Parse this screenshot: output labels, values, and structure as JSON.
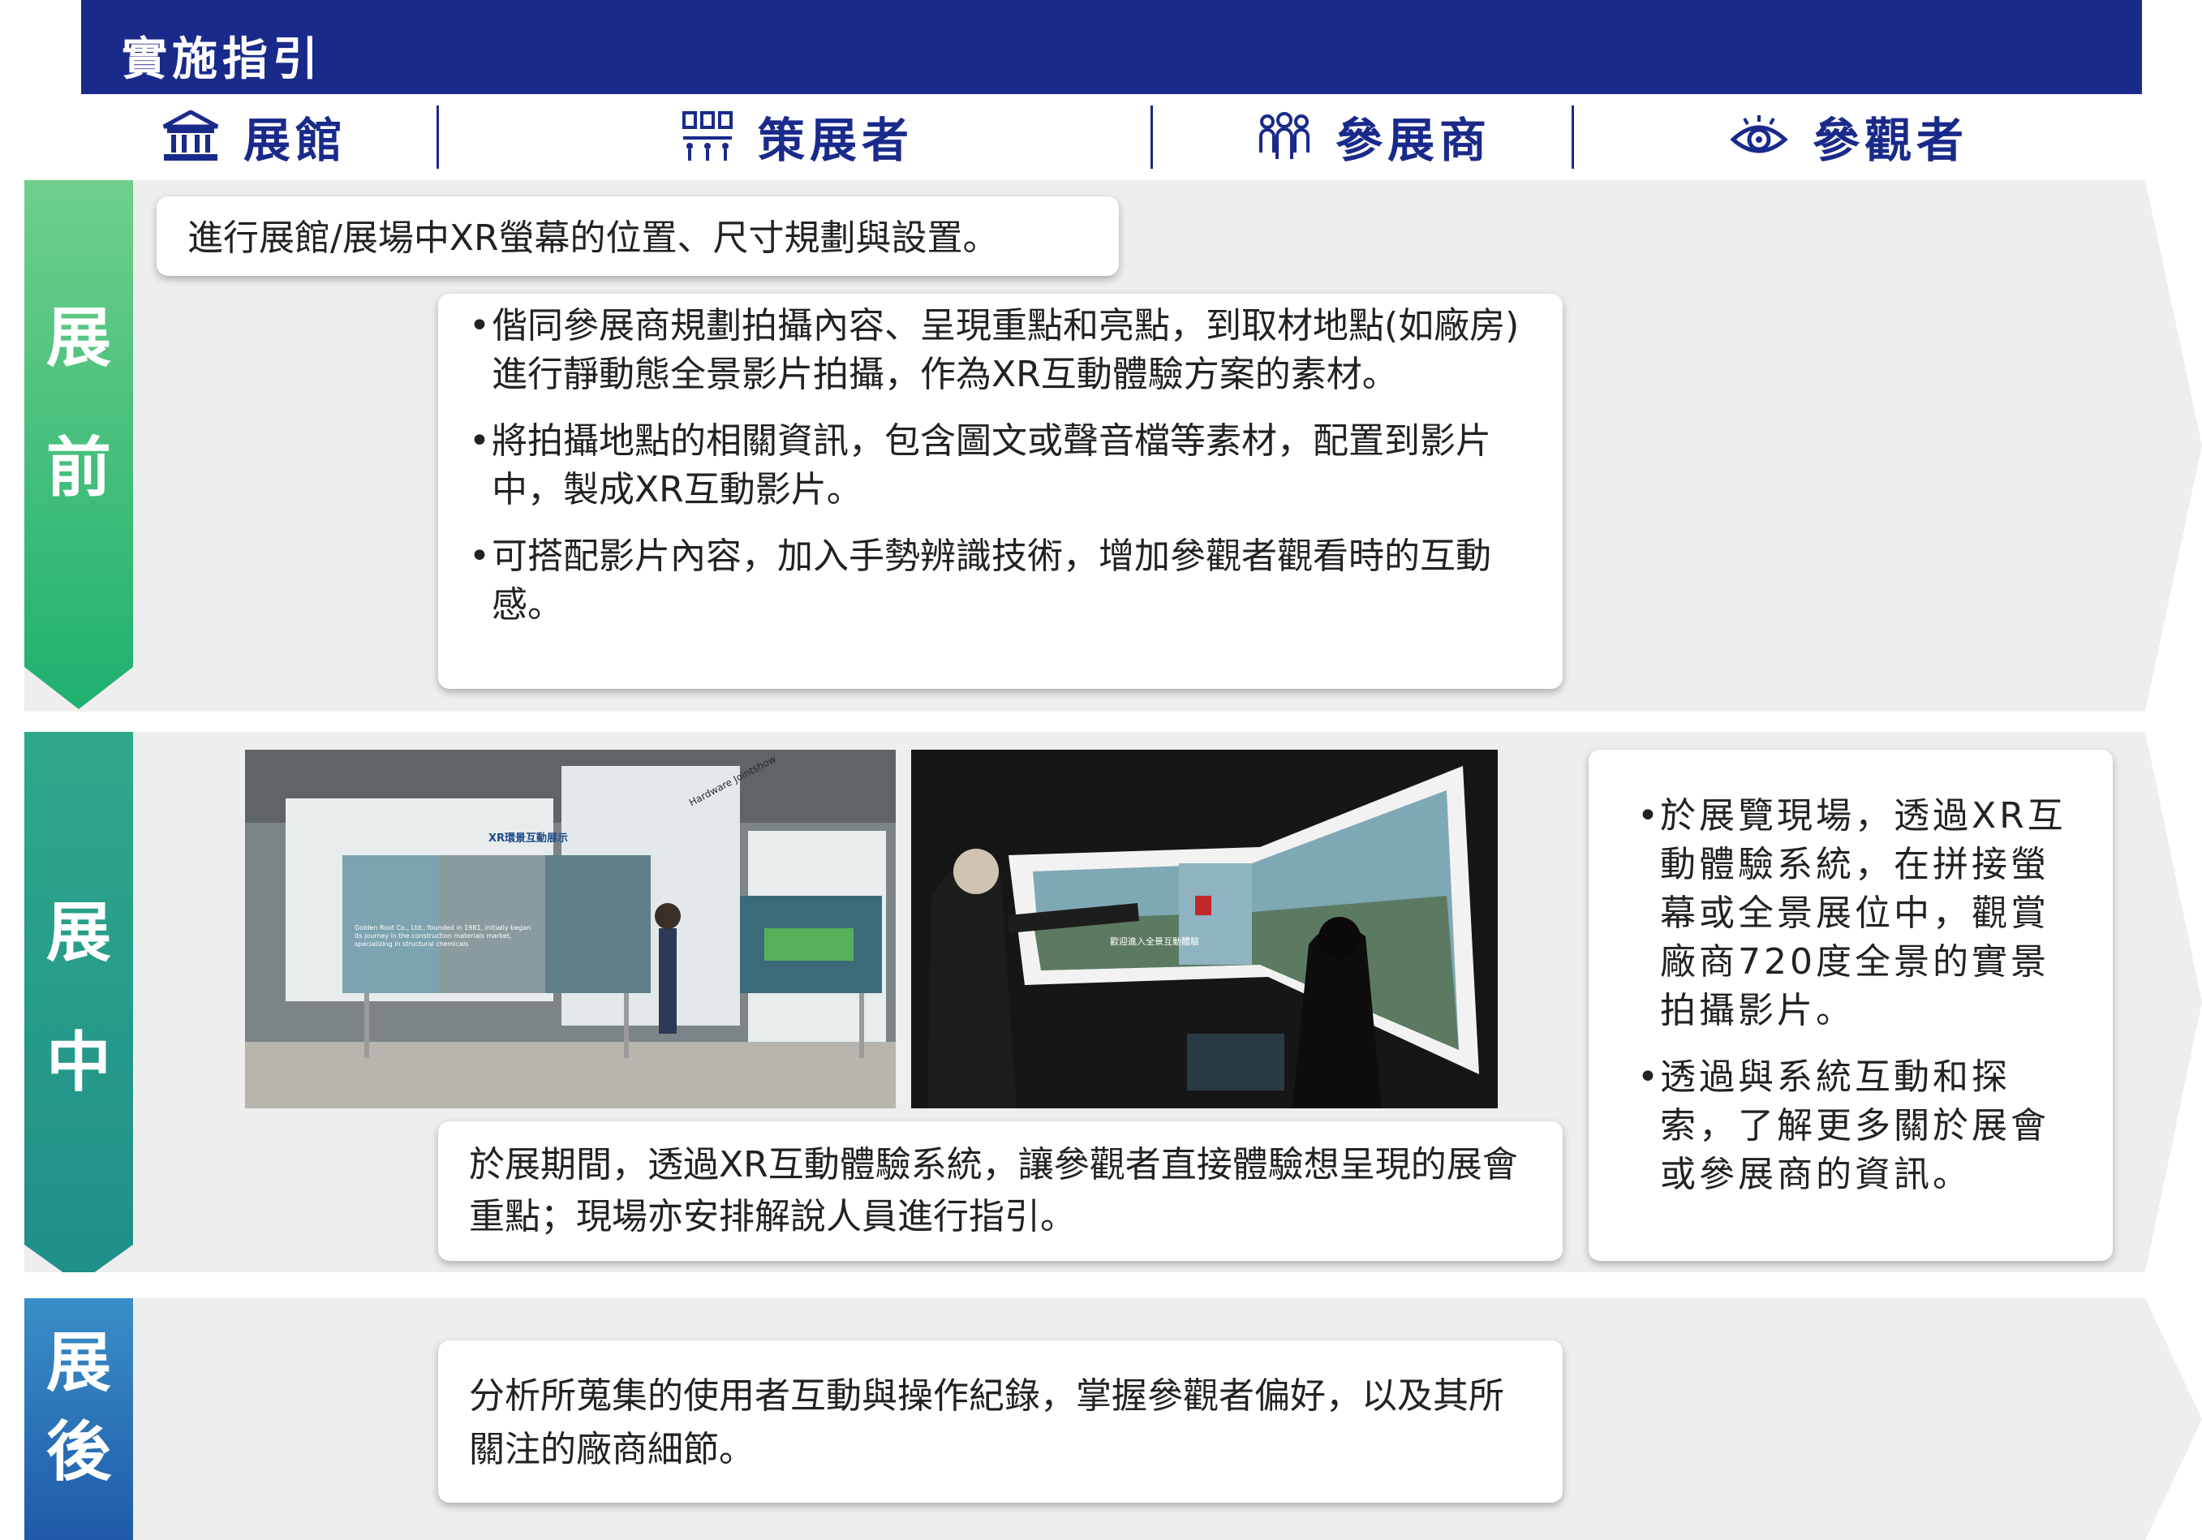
{
  "title": "實施指引",
  "columns": [
    {
      "label": "展館",
      "icon": "building-icon"
    },
    {
      "label": "策展者",
      "icon": "booth-network-icon"
    },
    {
      "label": "參展商",
      "icon": "people-group-icon"
    },
    {
      "label": "參觀者",
      "icon": "eye-icon"
    }
  ],
  "phases": {
    "before": {
      "line1": "展",
      "line2": "前"
    },
    "during": {
      "line1": "展",
      "line2": "中"
    },
    "after": {
      "line1": "展",
      "line2": "後"
    }
  },
  "before": {
    "venue_text": "進行展館/展場中XR螢幕的位置、尺寸規劃與設置。",
    "curator_items": [
      "偕同參展商規劃拍攝內容、呈現重點和亮點，到取材地點(如廠房)進行靜動態全景影片拍攝，作為XR互動體驗方案的素材。",
      "將拍攝地點的相關資訊，包含圖文或聲音檔等素材，配置到影片中，製成XR互動影片。",
      "可搭配影片內容，加入手勢辨識技術，增加參觀者觀看時的互動感。"
    ]
  },
  "during": {
    "photo1": {
      "booth_title": "XR環景互動展示",
      "side_sign": "Hardware Jointshow",
      "screen_caption": "Golden Root Co., Ltd., founded in 1981, initially began its journey in the construction materials market, specializing in structural chemicals"
    },
    "photo2": {
      "screen_caption": "歡迎進入全景互動體驗"
    },
    "curator_text": "於展期間，透過XR互動體驗系統，讓參觀者直接體驗想呈現的展會重點；現場亦安排解說人員進行指引。",
    "visitor_items": [
      "於展覽現場，透過XR互動體驗系統，在拼接螢幕或全景展位中，觀賞廠商720度全景的實景拍攝影片。",
      "透過與系統互動和探索，了解更多關於展會或參展商的資訊。"
    ]
  },
  "after": {
    "curator_text": "分析所蒐集的使用者互動與操作紀錄，掌握參觀者偏好，以及其所關注的廠商細節。"
  },
  "colors": {
    "navy": "#1a2a8a",
    "band_gray": "#eeeeee",
    "green_top": "#5cc88a",
    "teal_mid": "#2aa48c",
    "blue_bottom": "#1f6fb5"
  }
}
